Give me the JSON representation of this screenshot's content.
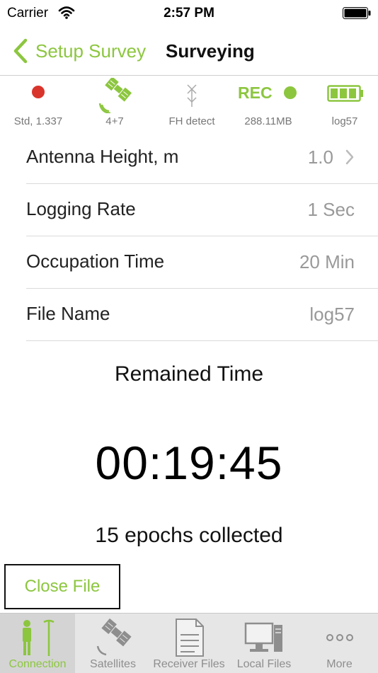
{
  "statusbar": {
    "carrier": "Carrier",
    "time": "2:57 PM"
  },
  "nav": {
    "back_label": "Setup Survey",
    "title": "Surveying"
  },
  "status": {
    "position": {
      "label": "Std, 1.337",
      "icon": "red-dot-icon"
    },
    "satellites": {
      "label": "4+7",
      "icon": "satellite-icon"
    },
    "radio": {
      "label": "FH detect",
      "icon": "antenna-icon"
    },
    "recording": {
      "text": "REC",
      "label": "288.11MB",
      "icon": "green-dot-icon"
    },
    "battery": {
      "label": "log57",
      "icon": "battery-icon"
    }
  },
  "settings": [
    {
      "label": "Antenna Height, m",
      "value": "1.0"
    },
    {
      "label": "Logging Rate",
      "value": "1 Sec"
    },
    {
      "label": "Occupation Time",
      "value": "20 Min"
    },
    {
      "label": "File Name",
      "value": "log57"
    }
  ],
  "survey": {
    "remained_label": "Remained Time",
    "timer": "00:19:45",
    "epochs": "15 epochs collected"
  },
  "close_button": "Close File",
  "tabs": [
    {
      "label": "Connection",
      "icon": "connection-icon",
      "active": true
    },
    {
      "label": "Satellites",
      "icon": "satellite-icon"
    },
    {
      "label": "Receiver Files",
      "icon": "document-icon"
    },
    {
      "label": "Local Files",
      "icon": "computer-icon"
    },
    {
      "label": "More",
      "icon": "more-icon"
    }
  ],
  "colors": {
    "accent": "#8cc63f",
    "alert": "#d9342b",
    "muted": "#999999"
  }
}
